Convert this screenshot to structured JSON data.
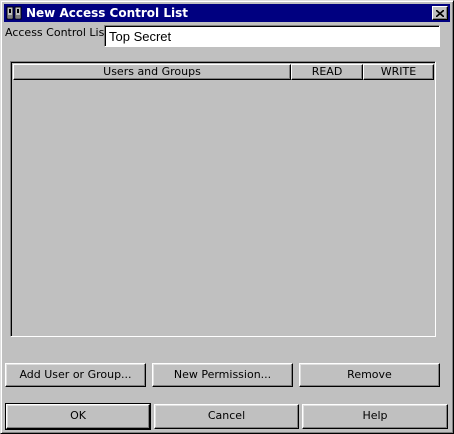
{
  "window": {
    "title": "New Access Control List",
    "icon": "acl-app-icon",
    "close_icon": "close-icon"
  },
  "acl": {
    "label": "Access Control List:",
    "value": "Top Secret"
  },
  "table": {
    "columns": [
      "Users and Groups",
      "READ",
      "WRITE"
    ],
    "rows": []
  },
  "actions": {
    "add_label": "Add User or Group...",
    "new_permission_label": "New Permission...",
    "remove_label": "Remove"
  },
  "dialog_buttons": {
    "ok_label": "OK",
    "cancel_label": "Cancel",
    "help_label": "Help"
  },
  "colors": {
    "titlebar": "#000080",
    "face": "#c0c0c0"
  }
}
